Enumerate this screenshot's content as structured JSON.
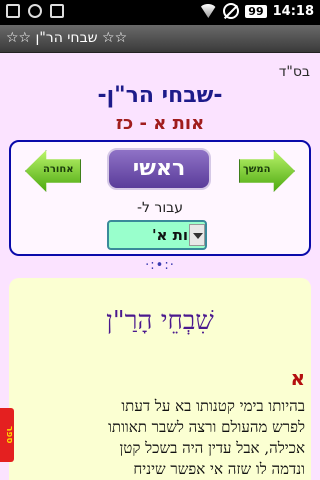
{
  "status_bar": {
    "battery": "99",
    "time": "14:18"
  },
  "titlebar": {
    "title": "☆☆ שבחי הר\"ן ☆☆"
  },
  "header": {
    "bsd": "בס\"ד",
    "title": "-שבחי הר\"ן-",
    "subtitle": "אות א - כז"
  },
  "nav": {
    "back_label": "אחורה",
    "start_label": "ראשי",
    "forward_label": "המשך",
    "go_to_label": "עבור ל-",
    "select_value": "אות א'"
  },
  "ornament": "·:•:·",
  "content": {
    "panel_title": "שִׁבְחֵי הָרַ\"ן",
    "letter": "א",
    "body_lines": [
      "בהיותו בימי קטנותו בא על דעתו",
      "לפרש מהעולם ורצה לשבר תאוותו",
      "אכילה, אבל עדין היה בשכל קטן",
      "ונדמה לו שזה אי אפשר שיניח"
    ]
  },
  "side_tab": {
    "label": "ספר"
  },
  "colors": {
    "background": "#fbe3ff",
    "title_blue": "#1d1b8a",
    "subtitle_red": "#a01d1d",
    "start_button": "#6a4cae",
    "select_green": "#99ffcc",
    "panel_bg": "#fbffd2"
  }
}
